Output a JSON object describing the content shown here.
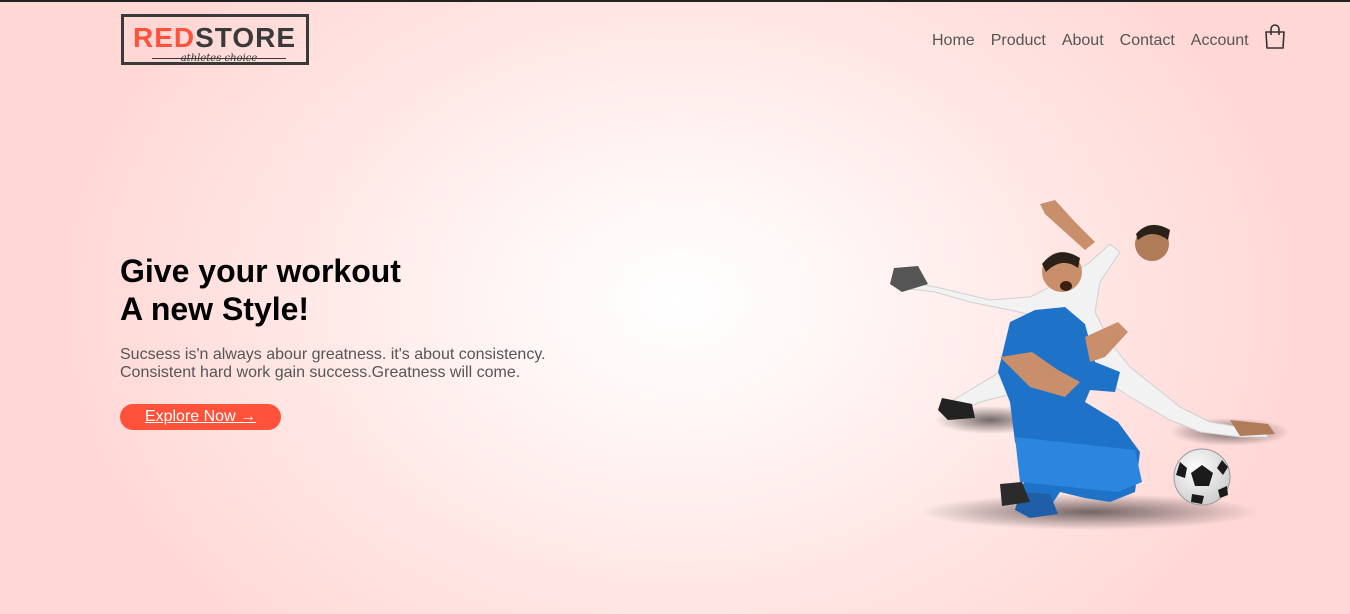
{
  "logo": {
    "brand_red": "RED",
    "brand_dark": "STORE",
    "tagline": "athletes choice"
  },
  "nav": {
    "items": [
      "Home",
      "Product",
      "About",
      "Contact",
      "Account"
    ],
    "cart_icon": "shopping-bag-icon"
  },
  "hero": {
    "title_line1": "Give your workout",
    "title_line2": "A new Style!",
    "desc_line1": "Sucsess is'n always abour greatness. it's about consistency.",
    "desc_line2": "Consistent hard work gain success.Greatness will come.",
    "button_label": "Explore Now →",
    "image": "football-players-image"
  },
  "colors": {
    "accent": "#ff523b",
    "text_dark": "#000000",
    "text_muted": "#555555",
    "logo_dark": "#3a3a3a"
  }
}
